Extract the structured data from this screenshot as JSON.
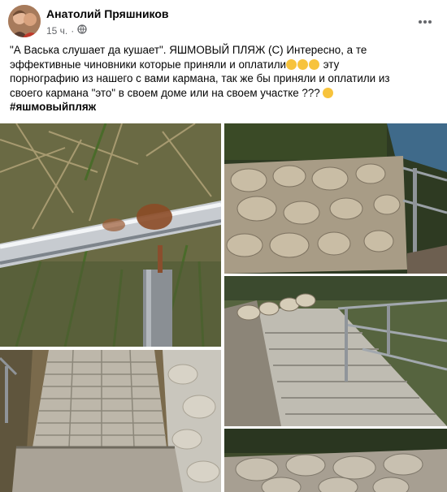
{
  "post": {
    "author": "Анатолий Пряшников",
    "time": "15 ч.",
    "separator": "·",
    "privacy_icon": "globe-icon",
    "more_icon": "more-options-icon",
    "text_line1": "\"А Васька слушает да кушает\". ЯШМОВЫЙ ПЛЯЖ (С)  Интересно, а те",
    "text_line2a": "эффективные чиновники которые приняли и оплатили",
    "text_line2b": " эту",
    "text_line3": "порнографию из нашего с вами кармана, так же бы приняли и оплатили  из",
    "text_line4": "своего кармана \"это\" в своем доме или на своем участке ??? ",
    "hashtag": "#яшмовыйпляж"
  },
  "photos": [
    {
      "name": "rusty-railing-photo"
    },
    {
      "name": "stone-wall-photo"
    },
    {
      "name": "stone-stairs-photo"
    },
    {
      "name": "paved-steps-photo"
    },
    {
      "name": "stairs-descending-photo"
    },
    {
      "name": "stone-wall-closeup-photo"
    }
  ]
}
